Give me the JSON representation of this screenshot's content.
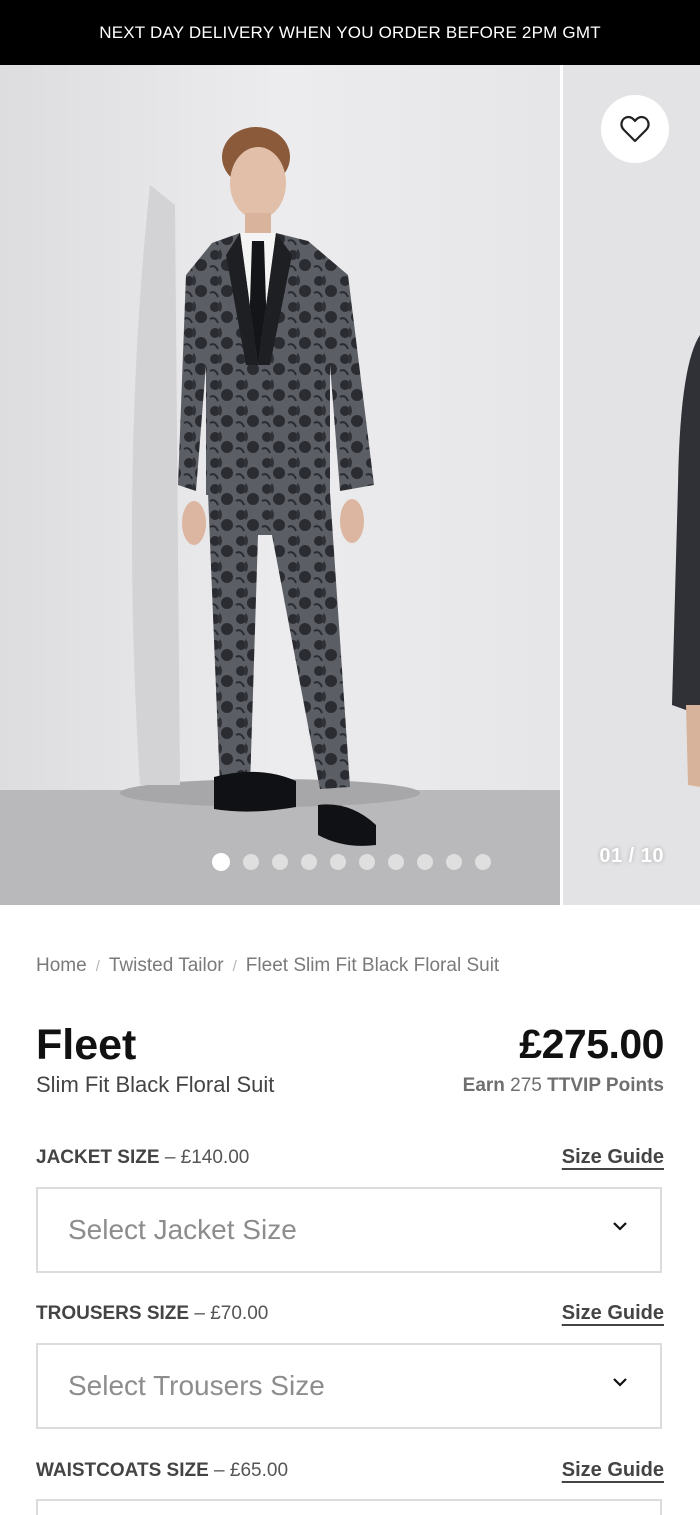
{
  "promo": {
    "text": "NEXT DAY DELIVERY WHEN YOU ORDER BEFORE 2PM GMT"
  },
  "gallery": {
    "counter": "01 / 10",
    "current_index": 1,
    "total": 10,
    "wishlist_icon": "heart-icon"
  },
  "breadcrumb": {
    "items": [
      "Home",
      "Twisted Tailor",
      "Fleet Slim Fit Black Floral Suit"
    ],
    "separator": "/"
  },
  "product": {
    "name": "Fleet",
    "subtitle": "Slim Fit Black Floral Suit",
    "price": "£275.00",
    "points": {
      "prefix": "Earn",
      "value": "275",
      "suffix": "TTVIP Points"
    }
  },
  "sizes": [
    {
      "label": "JACKET SIZE",
      "price": "£140.00",
      "guide": "Size Guide",
      "placeholder": "Select Jacket Size"
    },
    {
      "label": "TROUSERS SIZE",
      "price": "£70.00",
      "guide": "Size Guide",
      "placeholder": "Select Trousers Size"
    },
    {
      "label": "WAISTCOATS SIZE",
      "price": "£65.00",
      "guide": "Size Guide",
      "placeholder": ""
    }
  ],
  "colors": {
    "promo_bg": "#000000",
    "text": "#111111",
    "muted": "#7a7a7a",
    "border": "#dcdcdc"
  }
}
